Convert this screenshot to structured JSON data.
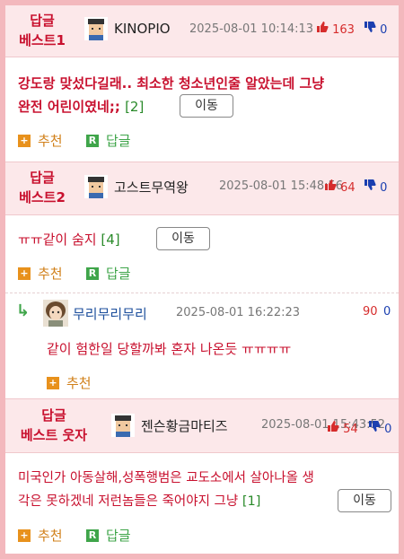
{
  "best1": {
    "badge_line1": "답글",
    "badge_line2": "베스트1",
    "nick": "KINOPIO",
    "date": "2025-08-01 10:14:13",
    "up": "163",
    "down": "0",
    "text_line1": "강도랑 맞섰다길래.. 최소한 청소년인줄 알았는데 그냥",
    "text_line2": "완전 어린이였네;;",
    "reply_count": "[2]",
    "move_label": "이동",
    "recommend_label": "추천",
    "reply_label": "답글"
  },
  "best2": {
    "badge_line1": "답글",
    "badge_line2": "베스트2",
    "nick": "고스트무역왕",
    "date": "2025-08-01 15:48:56",
    "up": "64",
    "down": "0",
    "text_line1": "ㅠㅠ같이 숨지",
    "reply_count": "[4]",
    "move_label": "이동",
    "recommend_label": "추천",
    "reply_label": "답글"
  },
  "reply": {
    "arrow": "↳",
    "nick": "무리무리무리",
    "date": "2025-08-01 16:22:23",
    "up": "90",
    "down": "0",
    "text": "같이 험한일 당할까봐 혼자 나온듯 ㅠㅠㅠㅠ",
    "recommend_label": "추천"
  },
  "best3": {
    "badge_line1": "답글",
    "badge_line2": "베스트 웃자",
    "nick": "젠슨황금마티즈",
    "date": "2025-08-01 15:43:52",
    "up": "54",
    "down": "0",
    "text_line1": "미국인가 아동살해,성폭행범은 교도소에서 살아나올 생",
    "text_line2": "각은 못하겠네 저런놈들은 죽어야지 그냥",
    "reply_count": "[1]",
    "move_label": "이동",
    "recommend_label": "추천",
    "reply_label": "답글"
  },
  "colors": {
    "accent_red": "#c8102e",
    "up_red": "#d62c2c",
    "down_blue": "#1b3fb0",
    "header_pink": "#fce8ea",
    "outer_pink": "#f3b8bd"
  }
}
